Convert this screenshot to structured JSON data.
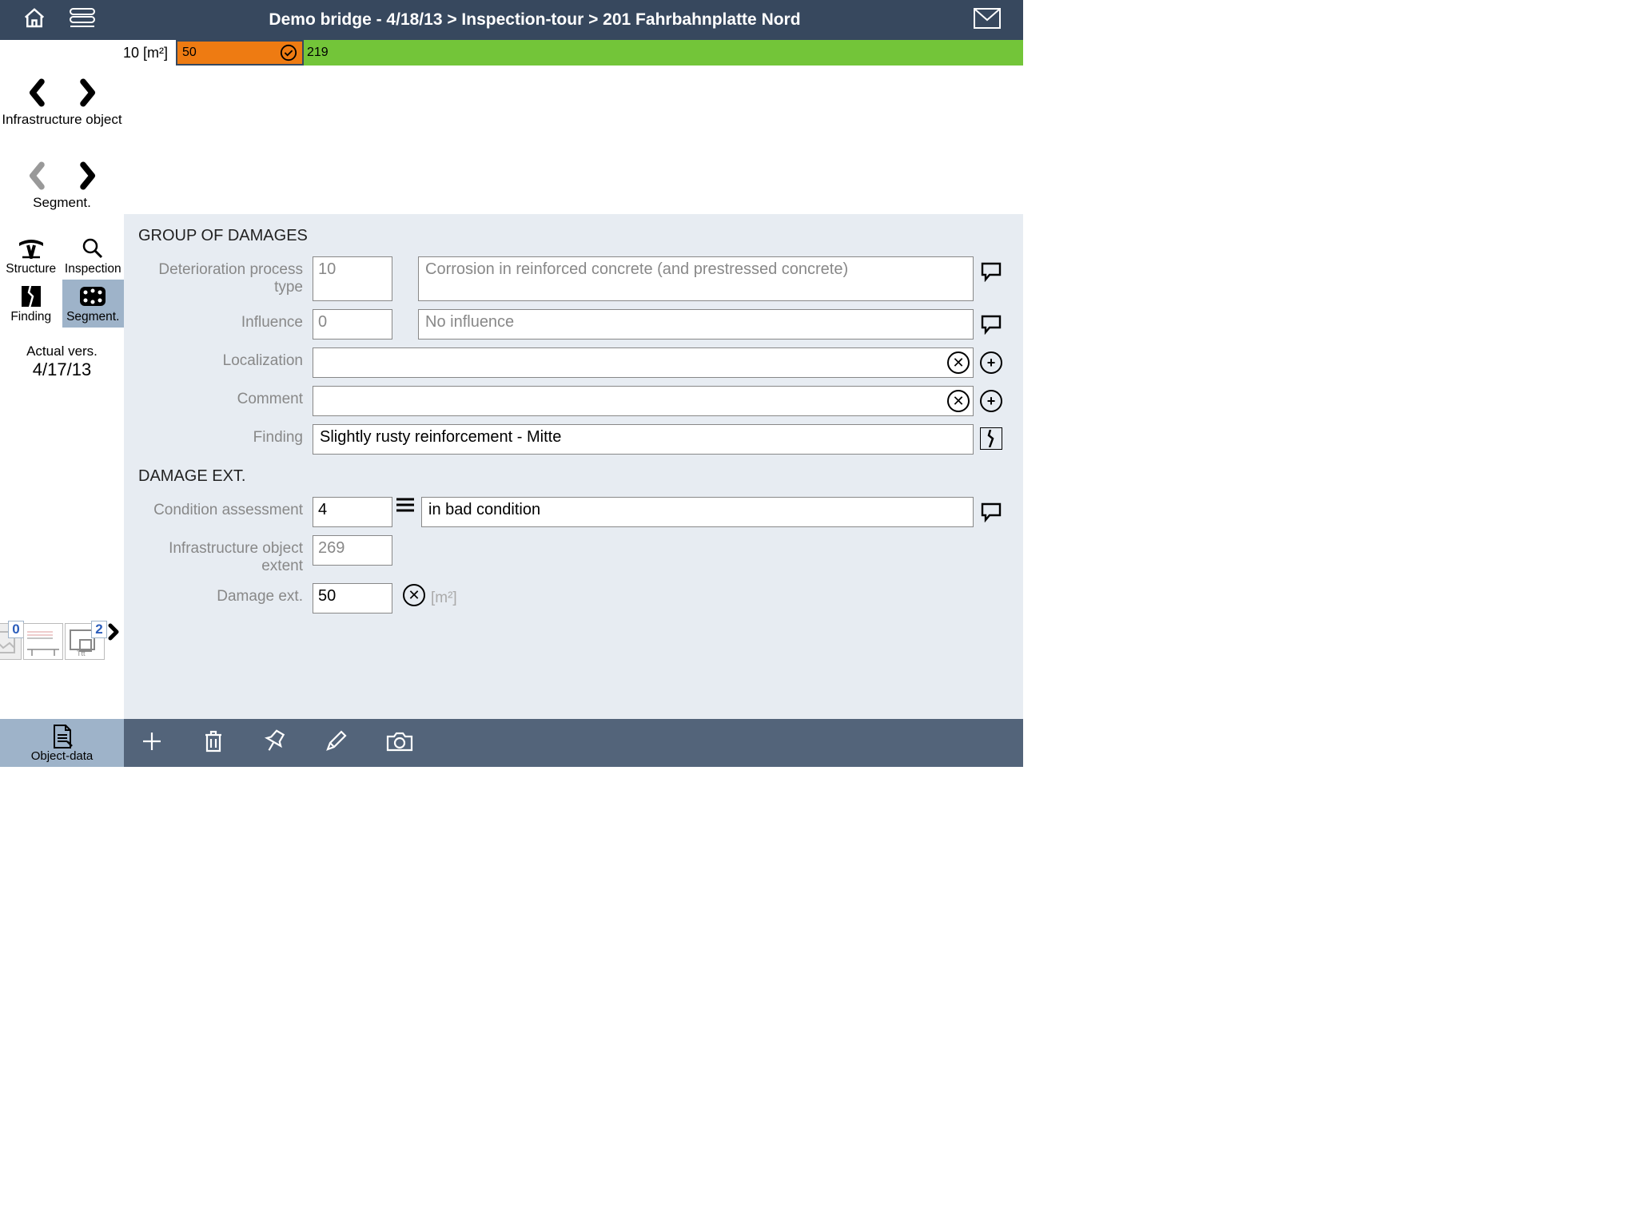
{
  "header": {
    "title": "Demo bridge - 4/18/13 > Inspection-tour > 201 Fahrbahnplatte Nord"
  },
  "progress": {
    "label": "10 [m²]",
    "done_value": "50",
    "remaining_value": "219"
  },
  "sidebar": {
    "nav1": "Infrastructure object",
    "nav2": "Segment.",
    "tabs": {
      "structure": "Structure",
      "inspection": "Inspection",
      "finding": "Finding",
      "segment": "Segment."
    },
    "version_label": "Actual vers.",
    "version_date": "4/17/13",
    "thumb_photo_count": "0",
    "thumb_plan_count": "2"
  },
  "form": {
    "section1_title": "GROUP OF DAMAGES",
    "deterioration_label": "Deterioration process type",
    "deterioration_code": "10",
    "deterioration_desc": "Corrosion in reinforced concrete (and prestressed concrete)",
    "influence_label": "Influence",
    "influence_code": "0",
    "influence_desc": "No influence",
    "localization_label": "Localization",
    "localization_value": "",
    "comment_label": "Comment",
    "comment_value": "",
    "finding_label": "Finding",
    "finding_value": "Slightly rusty reinforcement - Mitte",
    "section2_title": "DAMAGE EXT.",
    "condition_label": "Condition assessment",
    "condition_code": "4",
    "condition_desc": "in bad condition",
    "extent_label": "Infrastructure object extent",
    "extent_value": "269",
    "damage_ext_label": "Damage ext.",
    "damage_ext_value": "50",
    "damage_ext_unit": "[m²]"
  },
  "bottom": {
    "object_data": "Object-data"
  }
}
